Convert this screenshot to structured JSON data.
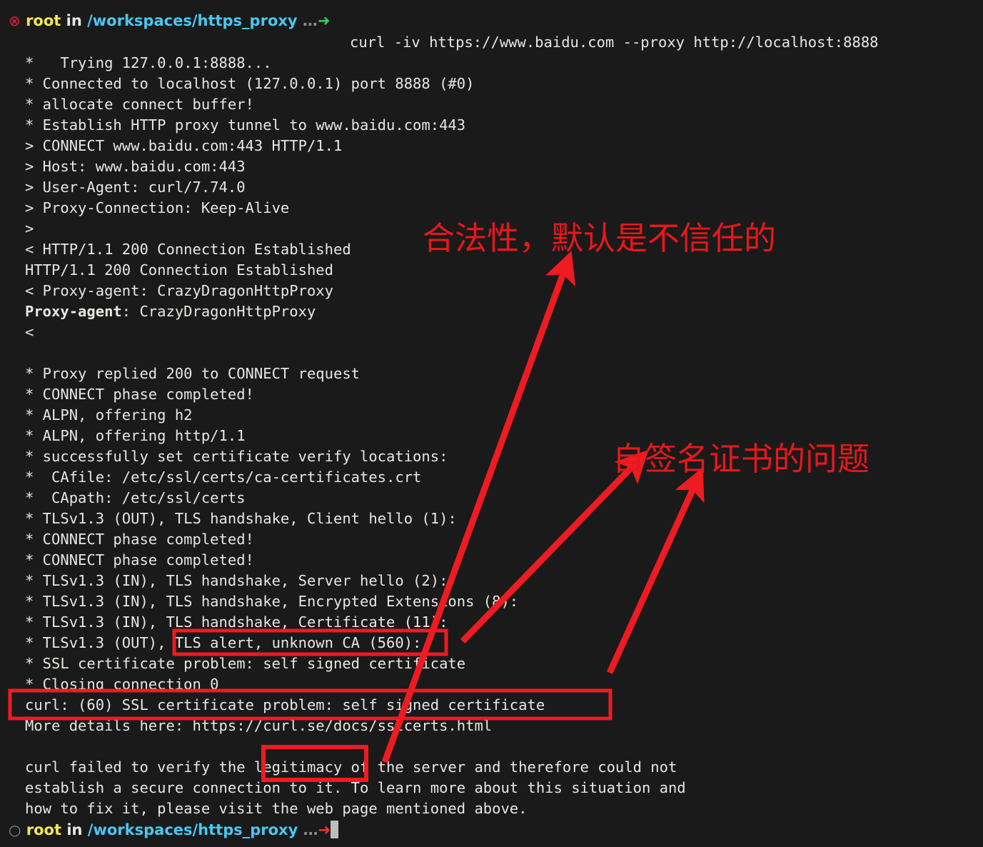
{
  "terminal": {
    "background_color": "#1a1a1a",
    "foreground_color": "#e8e6e3",
    "prompt_top": {
      "status_icon": "error-circle-x-icon",
      "status_glyph": "⊗",
      "user": "root",
      "in_word": "in",
      "path": "/workspaces/https_proxy",
      "ellipsis": "…",
      "arrow": "➜",
      "arrow_color": "#2fd44e",
      "user_color": "#f2e94e",
      "path_color": "#49c7f0"
    },
    "command": "curl -iv https://www.baidu.com --proxy http://localhost:8888",
    "prompt_bottom": {
      "status_icon": "circle-idle-icon",
      "status_glyph": "○",
      "user": "root",
      "in_word": "in",
      "path": "/workspaces/https_proxy",
      "ellipsis": "…",
      "arrow": "➜",
      "arrow_color": "#e8342a",
      "cursor": "block-cursor"
    },
    "output_lines": [
      "*   Trying 127.0.0.1:8888...",
      "* Connected to localhost (127.0.0.1) port 8888 (#0)",
      "* allocate connect buffer!",
      "* Establish HTTP proxy tunnel to www.baidu.com:443",
      "> CONNECT www.baidu.com:443 HTTP/1.1",
      "> Host: www.baidu.com:443",
      "> User-Agent: curl/7.74.0",
      "> Proxy-Connection: Keep-Alive",
      ">",
      "< HTTP/1.1 200 Connection Established",
      "HTTP/1.1 200 Connection Established",
      "< Proxy-agent: CrazyDragonHttpProxy"
    ],
    "bold_header_line": {
      "bold_part": "Proxy-agent",
      "rest": ": CrazyDragonHttpProxy"
    },
    "output_lines_2": [
      "<",
      "",
      "* Proxy replied 200 to CONNECT request",
      "* CONNECT phase completed!",
      "* ALPN, offering h2",
      "* ALPN, offering http/1.1",
      "* successfully set certificate verify locations:",
      "*  CAfile: /etc/ssl/certs/ca-certificates.crt",
      "*  CApath: /etc/ssl/certs",
      "* TLSv1.3 (OUT), TLS handshake, Client hello (1):",
      "* CONNECT phase completed!",
      "* CONNECT phase completed!",
      "* TLSv1.3 (IN), TLS handshake, Server hello (2):",
      "* TLSv1.3 (IN), TLS handshake, Encrypted Extensions (8):",
      "* TLSv1.3 (IN), TLS handshake, Certificate (11):",
      "* TLSv1.3 (OUT), TLS alert, unknown CA (560):",
      "* SSL certificate problem: self signed certificate",
      "* Closing connection 0",
      "curl: (60) SSL certificate problem: self signed certificate",
      "More details here: https://curl.se/docs/sslcerts.html",
      "",
      "curl failed to verify the legitimacy of the server and therefore could not",
      "establish a secure connection to it. To learn more about this situation and",
      "how to fix it, please visit the web page mentioned above."
    ]
  },
  "annotations": {
    "color": "#e8171b",
    "notes": [
      {
        "id": "note-1",
        "text": "合法性，默认是不信任的"
      },
      {
        "id": "note-2",
        "text": "自签名证书的问题"
      }
    ],
    "highlight_boxes": [
      {
        "id": "box-tls-alert",
        "label": "TLS alert, unknown CA (560):"
      },
      {
        "id": "box-curl-error",
        "label": "curl: (60) SSL certificate problem: self signed certificate"
      },
      {
        "id": "box-legitimacy",
        "label": "legitimacy"
      }
    ],
    "arrows": [
      {
        "id": "arrow-1",
        "from": "curl-error-line",
        "to": "note-1"
      },
      {
        "id": "arrow-2",
        "from": "tls-alert-box",
        "to": "note-2"
      },
      {
        "id": "arrow-3",
        "from": "ssl-problem-line",
        "to": "note-2"
      }
    ]
  }
}
